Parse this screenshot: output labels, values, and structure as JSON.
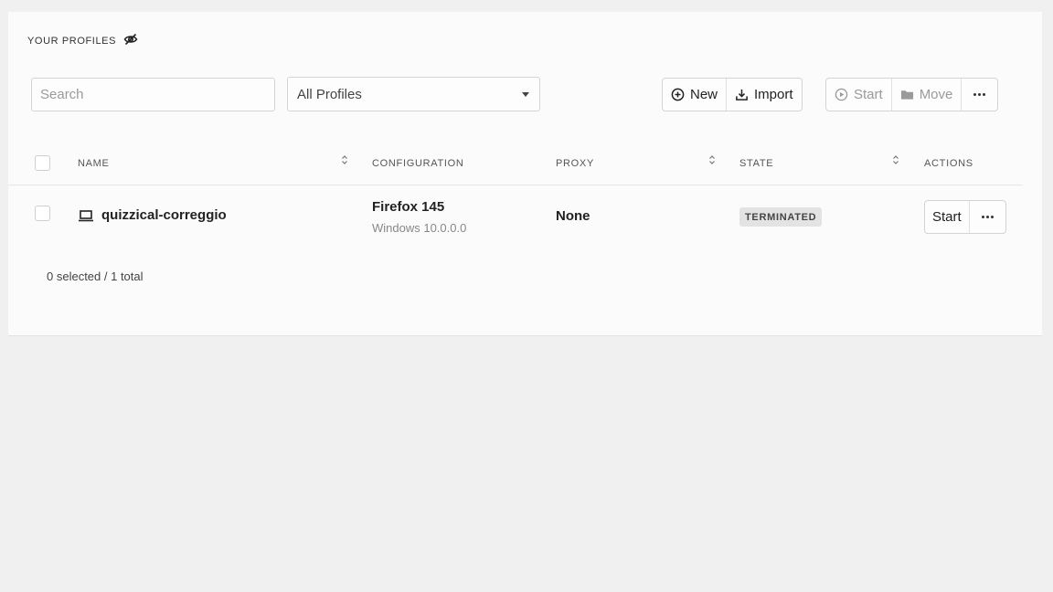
{
  "header": {
    "title": "YOUR PROFILES",
    "visibility_icon": "eye-off-icon"
  },
  "toolbar": {
    "search_placeholder": "Search",
    "filter_selected": "All Profiles",
    "new_label": "New",
    "import_label": "Import",
    "start_label": "Start",
    "move_label": "Move"
  },
  "table": {
    "columns": [
      "NAME",
      "CONFIGURATION",
      "PROXY",
      "STATE",
      "ACTIONS"
    ],
    "rows": [
      {
        "name": "quizzical-correggio",
        "configuration": "Firefox 145",
        "os": "Windows 10.0.0.0",
        "proxy": "None",
        "state": "TERMINATED",
        "action_label": "Start"
      }
    ]
  },
  "footer": {
    "selection_summary": "0 selected / 1 total"
  },
  "colors": {
    "background": "#f0f0f0",
    "card": "#fbfbfb",
    "badge": "#e3e3e3"
  }
}
